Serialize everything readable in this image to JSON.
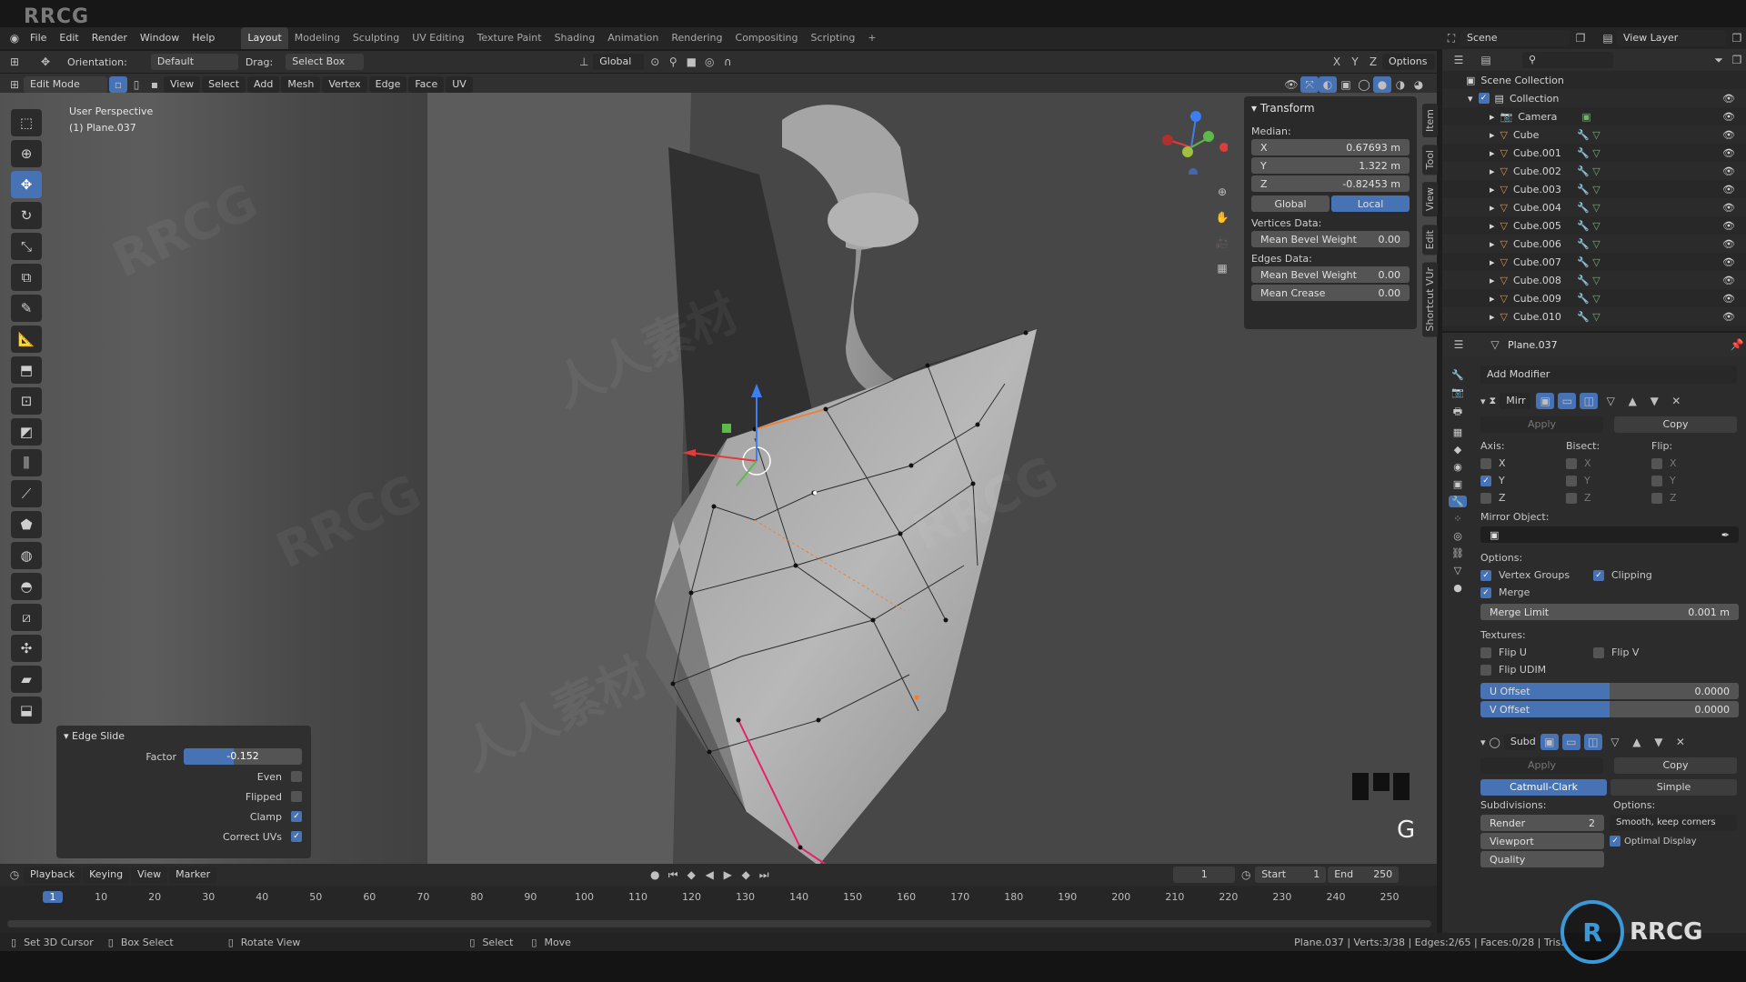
{
  "brand": "RRCG",
  "menu": [
    "File",
    "Edit",
    "Render",
    "Window",
    "Help"
  ],
  "workspaces": [
    "Layout",
    "Modeling",
    "Sculpting",
    "UV Editing",
    "Texture Paint",
    "Shading",
    "Animation",
    "Rendering",
    "Compositing",
    "Scripting"
  ],
  "active_workspace": "Layout",
  "scene": "Scene",
  "view_layer": "View Layer",
  "header": {
    "orientation_label": "Orientation:",
    "orientation_value": "Default",
    "drag_label": "Drag:",
    "drag_value": "Select Box",
    "transform_space": "Global",
    "options": "Options"
  },
  "mode_bar": {
    "mode": "Edit Mode",
    "menus": [
      "View",
      "Select",
      "Add",
      "Mesh",
      "Vertex",
      "Edge",
      "Face",
      "UV"
    ]
  },
  "viewport": {
    "perspective": "User Perspective",
    "object": "(1) Plane.037",
    "key_overlay": "G"
  },
  "npanel": {
    "title": "Transform",
    "median_label": "Median:",
    "x_label": "X",
    "x": "0.67693 m",
    "y_label": "Y",
    "y": "1.322 m",
    "z_label": "Z",
    "z": "-0.82453 m",
    "global": "Global",
    "local": "Local",
    "vertices_data": "Vertices Data:",
    "mean_bevel_weight": "Mean Bevel Weight",
    "v_bevel": "0.00",
    "edges_data": "Edges Data:",
    "e_bevel": "0.00",
    "mean_crease": "Mean Crease",
    "crease": "0.00",
    "tabs": [
      "Item",
      "Tool",
      "View",
      "Edit",
      "Shortcut VUr"
    ]
  },
  "outliner": {
    "root": "Scene Collection",
    "collection": "Collection",
    "items": [
      "Camera",
      "Cube",
      "Cube.001",
      "Cube.002",
      "Cube.003",
      "Cube.004",
      "Cube.005",
      "Cube.006",
      "Cube.007",
      "Cube.008",
      "Cube.009",
      "Cube.010"
    ]
  },
  "properties": {
    "object": "Plane.037",
    "add_modifier": "Add Modifier",
    "mirror": {
      "name": "Mirr",
      "apply": "Apply",
      "copy": "Copy",
      "axis_label": "Axis:",
      "bisect_label": "Bisect:",
      "flip_label": "Flip:",
      "axes": [
        "X",
        "Y",
        "Z"
      ],
      "mirror_object": "Mirror Object:",
      "options_label": "Options:",
      "vertex_groups": "Vertex Groups",
      "clipping": "Clipping",
      "merge": "Merge",
      "merge_limit_label": "Merge Limit",
      "merge_limit": "0.001 m",
      "textures_label": "Textures:",
      "flip_u": "Flip U",
      "flip_v": "Flip V",
      "flip_udim": "Flip UDIM",
      "u_offset_label": "U Offset",
      "u_offset": "0.0000",
      "v_offset_label": "V Offset",
      "v_offset": "0.0000"
    },
    "subsurf": {
      "name": "Subd",
      "apply": "Apply",
      "copy": "Copy",
      "catmull": "Catmull-Clark",
      "simple": "Simple",
      "subdivisions": "Subdivisions:",
      "options": "Options:",
      "render_label": "Render",
      "render": "2",
      "viewport_label": "Viewport",
      "quality_label": "Quality",
      "uv_smooth": "Smooth, keep corners",
      "optimal_display": "Optimal Display"
    }
  },
  "edge_slide": {
    "title": "Edge Slide",
    "factor_label": "Factor",
    "factor": "-0.152",
    "factor_fill": 0.42,
    "even": "Even",
    "flipped": "Flipped",
    "clamp": "Clamp",
    "correct_uvs": "Correct UVs"
  },
  "timeline": {
    "menus": [
      "Playback",
      "Keying",
      "View",
      "Marker"
    ],
    "current_frame": "1",
    "start_label": "Start",
    "start": "1",
    "end_label": "End",
    "end": "250",
    "ticks": [
      "1",
      "10",
      "20",
      "30",
      "40",
      "50",
      "60",
      "70",
      "80",
      "90",
      "100",
      "110",
      "120",
      "130",
      "140",
      "150",
      "160",
      "170",
      "180",
      "190",
      "200",
      "210",
      "220",
      "230",
      "240",
      "250"
    ]
  },
  "statusbar": {
    "set_cursor": "Set 3D Cursor",
    "box_select": "Box Select",
    "rotate_view": "Rotate View",
    "select": "Select",
    "move": "Move",
    "stats": "Plane.037 | Verts:3/38 | Edges:2/65 | Faces:0/28 | Tris:"
  },
  "colors": {
    "accent": "#4772b3",
    "viewport_bg": "#3a3a3a",
    "panel_bg": "#2c2c2c",
    "edge_selected": "#ff7a20",
    "seam": "#e8206a"
  }
}
